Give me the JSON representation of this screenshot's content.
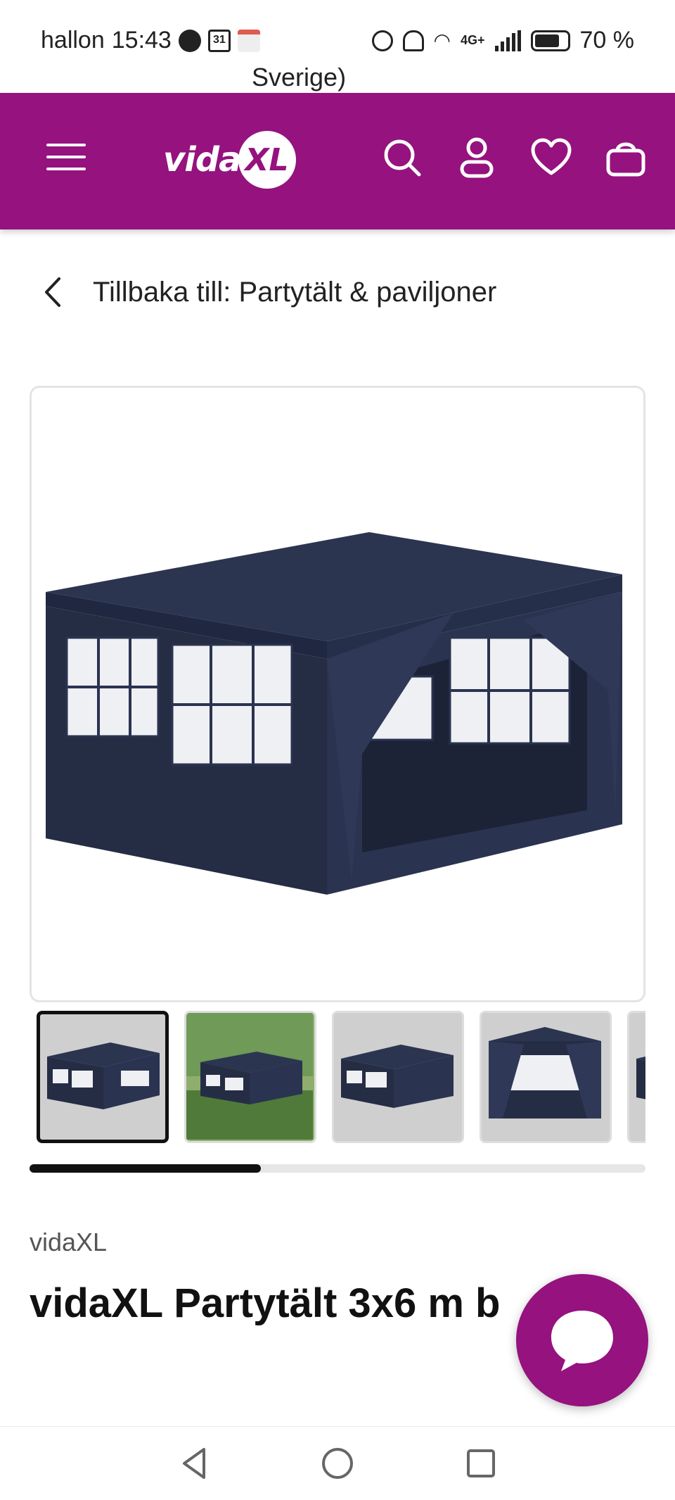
{
  "status_bar": {
    "carrier": "hallon",
    "time": "15:43",
    "calendar_day": "31",
    "network": "4G+",
    "battery": "70 %"
  },
  "overlay_text": "Sverige)",
  "header": {
    "logo_text": "vida",
    "logo_badge": "XL",
    "brand_color": "#95127f",
    "icons": [
      "menu-icon",
      "search-icon",
      "user-icon",
      "heart-icon",
      "cart-icon"
    ]
  },
  "back_link": {
    "label": "Tillbaka till: Partytält & paviljoner"
  },
  "gallery": {
    "thumbnail_count_visible": 5,
    "active_index": 0,
    "scroll_progress": 0.375
  },
  "product": {
    "brand": "vidaXL",
    "title": "vidaXL Partytält 3x6 m b"
  },
  "nav_bar": {
    "icons": [
      "back-icon",
      "home-icon",
      "recents-icon"
    ]
  }
}
